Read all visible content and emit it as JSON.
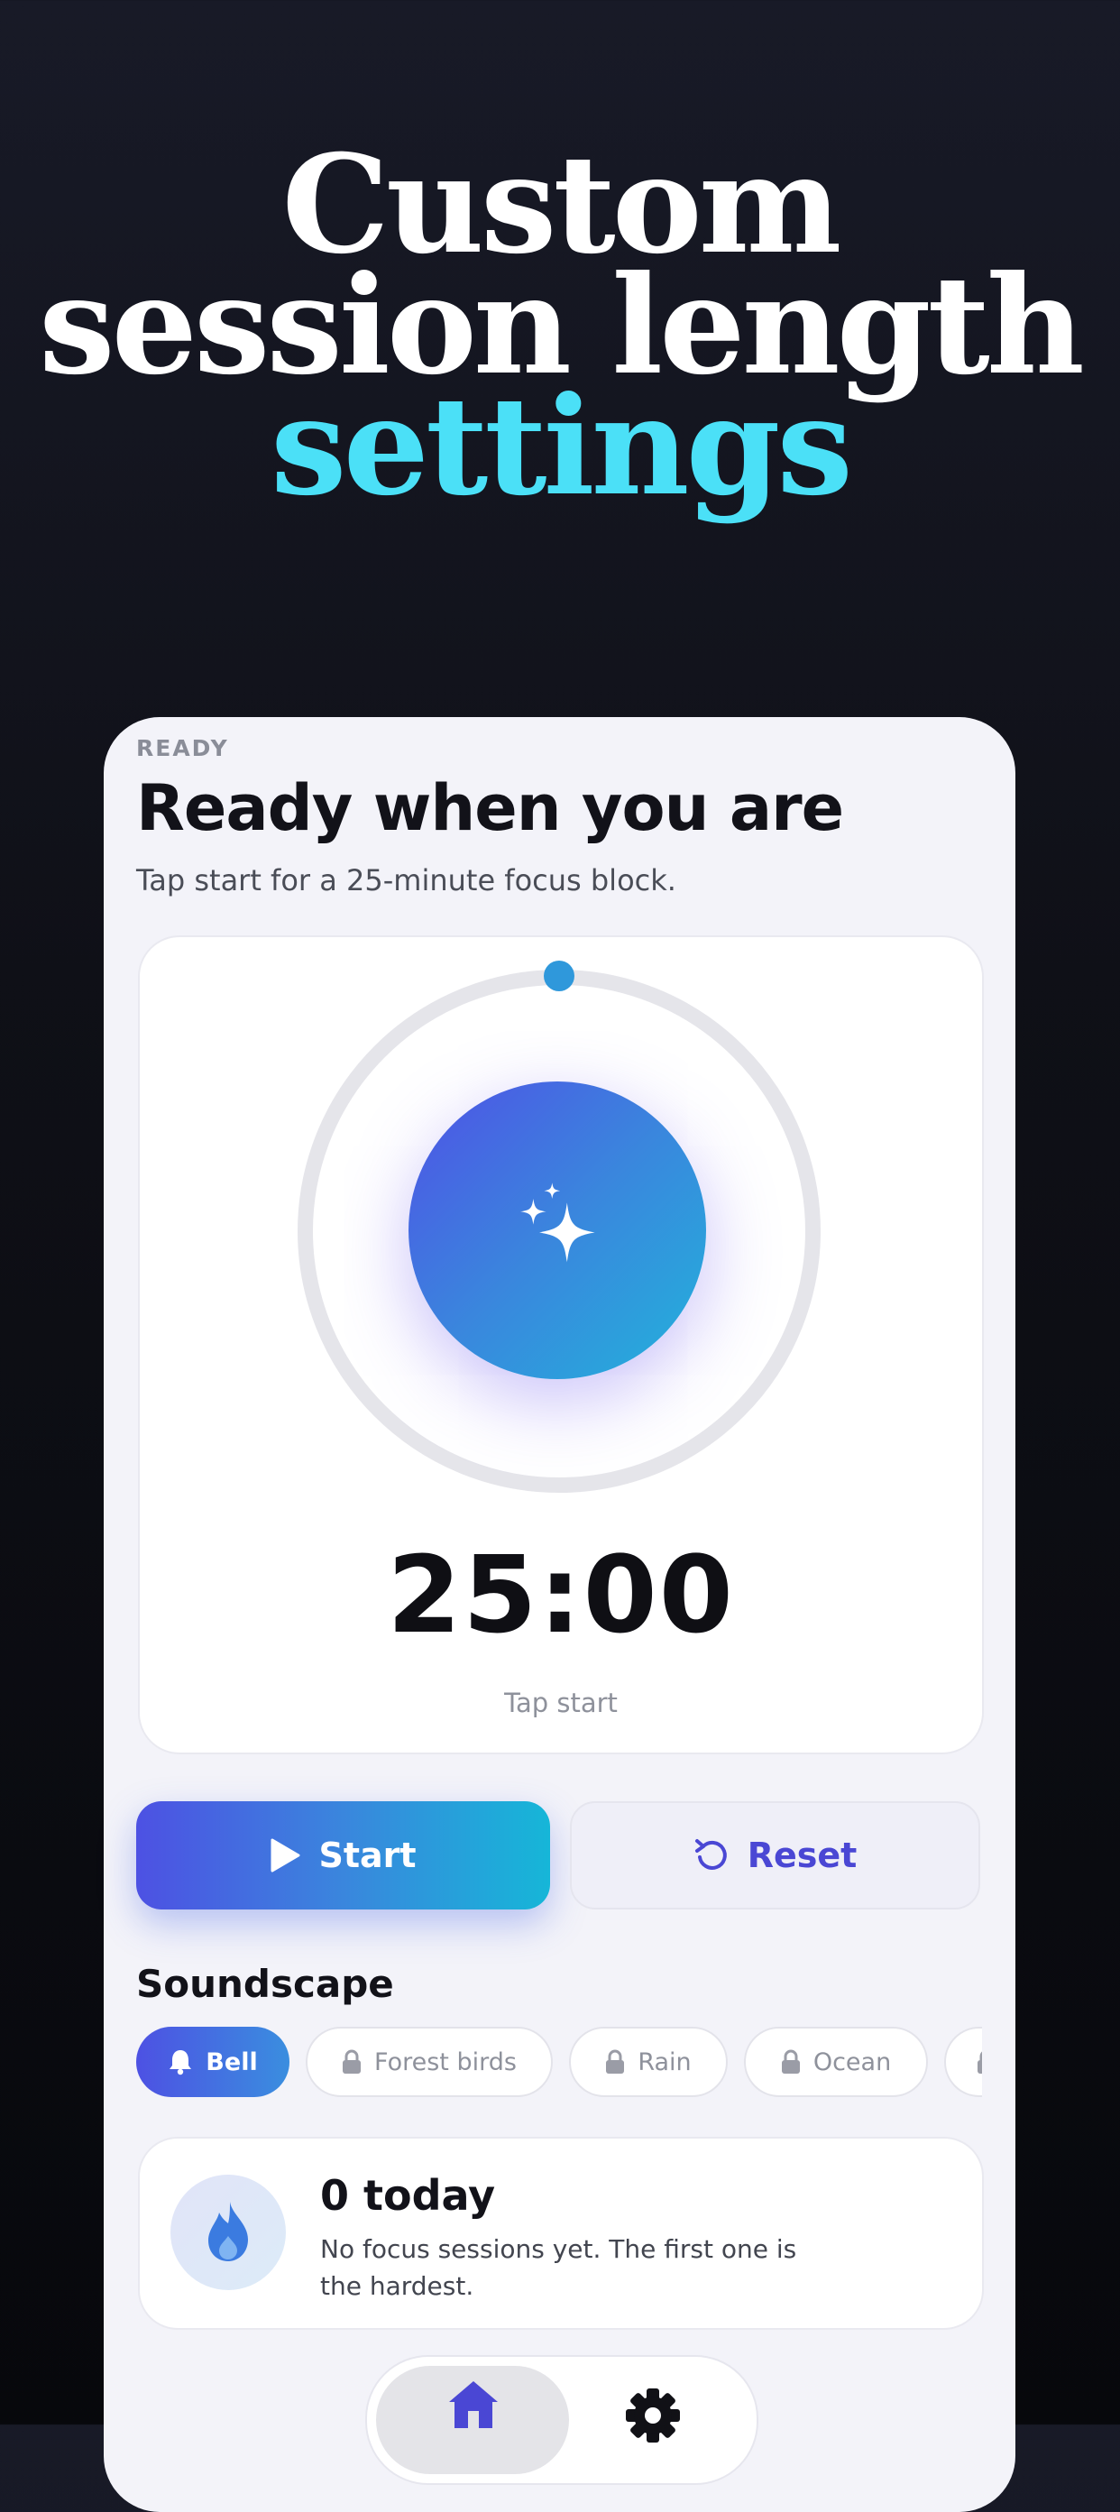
{
  "hero": {
    "line1": "Custom",
    "line2": "session length",
    "line3": "settings"
  },
  "session": {
    "status": "READY",
    "headline": "Ready when you are",
    "subline": "Tap start for a 25-minute focus block.",
    "time": "25:00",
    "hint": "Tap start",
    "progress": 0
  },
  "actions": {
    "start_label": "Start",
    "reset_label": "Reset"
  },
  "soundscape": {
    "title": "Soundscape",
    "chips": [
      {
        "label": "Bell",
        "selected": true,
        "locked": false
      },
      {
        "label": "Forest birds",
        "selected": false,
        "locked": true
      },
      {
        "label": "Rain",
        "selected": false,
        "locked": true
      },
      {
        "label": "Ocean",
        "selected": false,
        "locked": true
      }
    ]
  },
  "stats": {
    "count": "0 today",
    "text": "No focus sessions yet. The first one is the hardest."
  },
  "tabs": [
    {
      "icon": "home-icon",
      "active": true
    },
    {
      "icon": "gear-icon",
      "active": false
    }
  ],
  "colors": {
    "accent": "#4be0f7",
    "brand_start": "#4d51e3",
    "brand_end": "#16b6d8"
  }
}
